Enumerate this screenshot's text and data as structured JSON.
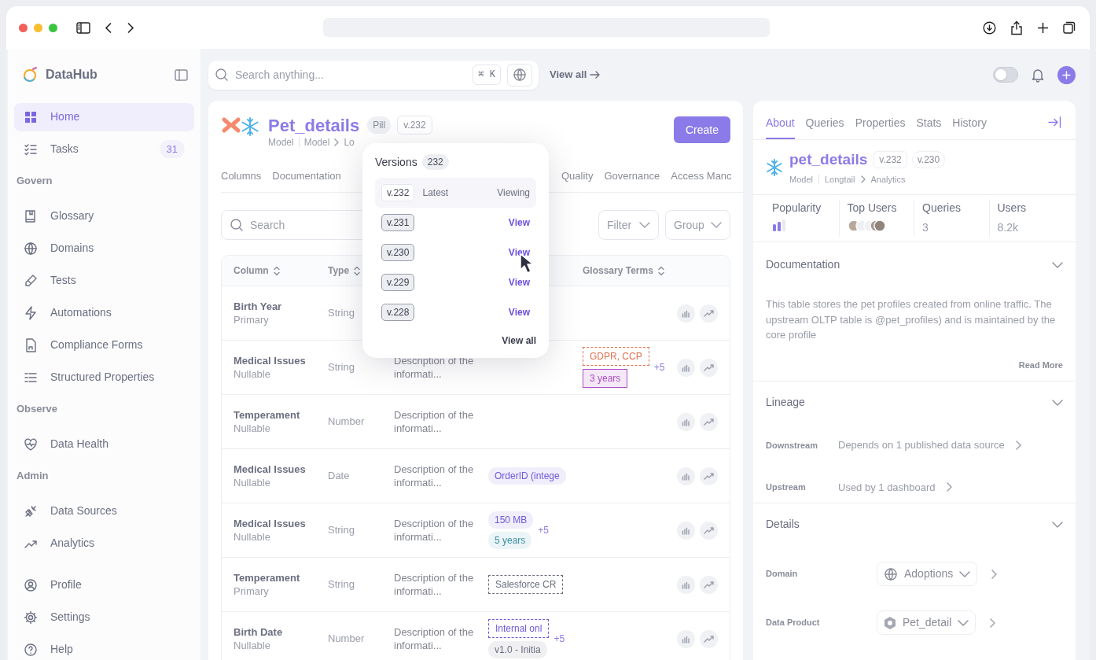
{
  "sidebar": {
    "brand": "DataHub",
    "sections": [
      {
        "items": [
          {
            "label": "Home",
            "selected": true
          },
          {
            "label": "Tasks",
            "selected": false,
            "count": "31"
          }
        ]
      },
      {
        "heading": "Govern",
        "items": [
          {
            "label": "Glossary",
            "selected": false
          },
          {
            "label": "Domains",
            "selected": false
          },
          {
            "label": "Tests",
            "selected": false
          },
          {
            "label": "Automations",
            "selected": false
          },
          {
            "label": "Compliance Forms",
            "selected": false
          },
          {
            "label": "Structured Properties",
            "selected": false
          }
        ]
      },
      {
        "heading": "Observe",
        "items": [
          {
            "label": "Data Health",
            "selected": false
          }
        ]
      },
      {
        "heading": "Admin",
        "items": [
          {
            "label": "Data Sources",
            "selected": false
          },
          {
            "label": "Analytics",
            "selected": false
          }
        ]
      },
      {
        "items": [
          {
            "label": "Profile",
            "selected": false
          },
          {
            "label": "Settings",
            "selected": false
          },
          {
            "label": "Help",
            "selected": false
          }
        ]
      }
    ]
  },
  "top_bar": {
    "search_placeholder": "Search anything...",
    "shortcut": "⌘ K",
    "view_all": "View all",
    "theme_toggle_on": false
  },
  "entity": {
    "title": "Pet_details",
    "badges": [
      "Pill",
      "v.232"
    ],
    "breadcrumb": [
      "Model",
      "Model",
      "Lo"
    ],
    "create": "Create",
    "tabs": [
      "Columns",
      "Documentation",
      "Quality",
      "Governance",
      "Access Manc"
    ],
    "search_placeholder": "Search",
    "filter": "Filter",
    "group": "Group",
    "table": {
      "columns": [
        {
          "label": "Column",
          "kind": "name"
        },
        {
          "label": "Type",
          "kind": "type"
        },
        {
          "label": "Glossary Terms",
          "kind": "glossary"
        }
      ],
      "rows": [
        {
          "name": "Birth Year",
          "sub": "Primary",
          "type": "String"
        },
        {
          "name": "Medical Issues",
          "sub": "Nullable",
          "type": "String",
          "description": "Description of the informati...",
          "glossary": [
            {
              "text": "GDPR, CCP",
              "kind": "dashed",
              "color": "#d9734f"
            },
            {
              "text": "3 years",
              "kind": "outlined",
              "color": "#a94fc4"
            }
          ],
          "glossary_more": "+5"
        },
        {
          "name": "Temperament",
          "sub": "Nullable",
          "type": "Number",
          "description": "Description of the informati..."
        },
        {
          "name": "Medical Issues",
          "sub": "Nullable",
          "type": "Date",
          "description": "Description of the informati...",
          "tags": [
            {
              "text": "OrderID (intege",
              "kind": "filled",
              "color": "#6d5ad8"
            }
          ]
        },
        {
          "name": "Medical Issues",
          "sub": "Nullable",
          "type": "String",
          "description": "Description of the informati...",
          "tags": [
            {
              "text": "150 MB",
              "kind": "filled",
              "color": "#6d5ad8"
            },
            {
              "text": "5 years",
              "kind": "filled",
              "color": "#3a8fa3"
            }
          ],
          "tags_more": "+5"
        },
        {
          "name": "Temperament",
          "sub": "Primary",
          "type": "String",
          "description": "Description of the informati...",
          "tags": [
            {
              "text": "Salesforce CR",
              "kind": "dashed",
              "color": "#6b6f80"
            }
          ]
        },
        {
          "name": "Birth Date",
          "sub": "Nullable",
          "type": "Number",
          "description": "Description of the informati...",
          "tags": [
            {
              "text": "Internal onl",
              "kind": "dashed",
              "color": "#6d5ad8"
            },
            {
              "text": "v1.0 - Initia",
              "kind": "filled",
              "color": "#6b6f80"
            }
          ],
          "tags_more": "+5"
        }
      ]
    }
  },
  "versions_popover": {
    "title": "Versions",
    "count": "232",
    "items": [
      {
        "version": "v.232",
        "note": "Latest",
        "action": "Viewing",
        "selected": true
      },
      {
        "version": "v.231",
        "action": "View",
        "selected": false
      },
      {
        "version": "v.230",
        "action": "View",
        "selected": false
      },
      {
        "version": "v.229",
        "action": "View",
        "selected": false
      },
      {
        "version": "v.228",
        "action": "View",
        "selected": false
      }
    ],
    "footer": "View all"
  },
  "side_panel": {
    "tabs": [
      {
        "label": "About",
        "selected": true
      },
      {
        "label": "Queries",
        "selected": false
      },
      {
        "label": "Properties",
        "selected": false
      },
      {
        "label": "Stats",
        "selected": false
      },
      {
        "label": "History",
        "selected": false
      }
    ],
    "name": "pet_details",
    "versions": [
      "v.232",
      "v.230"
    ],
    "breadcrumb": [
      "Model",
      "Longtail",
      "Analytics"
    ],
    "stats": [
      {
        "label": "Popularity",
        "kind": "bars"
      },
      {
        "label": "Top Users",
        "kind": "avatars"
      },
      {
        "label": "Queries",
        "kind": "text",
        "value": "3"
      },
      {
        "label": "Users",
        "kind": "text",
        "value": "8.2k"
      }
    ],
    "documentation": {
      "title": "Documentation",
      "text": "This table stores the pet profiles created from online traffic. The upstream OLTP table is @pet_profiles) and is maintained by the core profile",
      "link": "Read More"
    },
    "lineage": {
      "title": "Lineage",
      "rows": [
        {
          "label": "Downstream",
          "value": "Depends on 1 published data source"
        },
        {
          "label": "Upstream",
          "value": "Used by 1 dashboard"
        }
      ]
    },
    "details": {
      "title": "Details",
      "rows": [
        {
          "label": "Domain",
          "value": "Adoptions",
          "kind": "domain"
        },
        {
          "label": "Data Product",
          "value": "Pet_detail",
          "kind": "product"
        }
      ]
    }
  }
}
